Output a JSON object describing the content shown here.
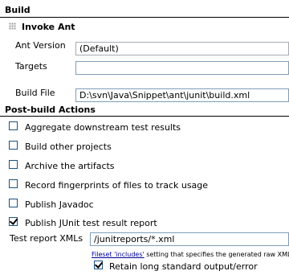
{
  "build": {
    "section_title": "Build",
    "step_title": "Invoke Ant",
    "ant_version_label": "Ant Version",
    "ant_version_value": "(Default)",
    "targets_label": "Targets",
    "targets_value": "",
    "build_file_label": "Build File",
    "build_file_value": "D:\\svn\\Java\\Snippet\\ant\\junit\\build.xml"
  },
  "post_build": {
    "section_title": "Post-build Actions",
    "actions": [
      {
        "label": "Aggregate downstream test results",
        "checked": false
      },
      {
        "label": "Build other projects",
        "checked": false
      },
      {
        "label": "Archive the artifacts",
        "checked": false
      },
      {
        "label": "Record fingerprints of files to track usage",
        "checked": false
      },
      {
        "label": "Publish Javadoc",
        "checked": false
      },
      {
        "label": "Publish JUnit test result report",
        "checked": true
      }
    ],
    "junit": {
      "xmls_label": "Test report XMLs",
      "xmls_value": "/junitreports/*.xml",
      "help_link": "Fileset 'includes'",
      "help_text": " setting that specifies the generated raw XML",
      "retain_label": "Retain long standard output/error",
      "retain_checked": true
    }
  }
}
